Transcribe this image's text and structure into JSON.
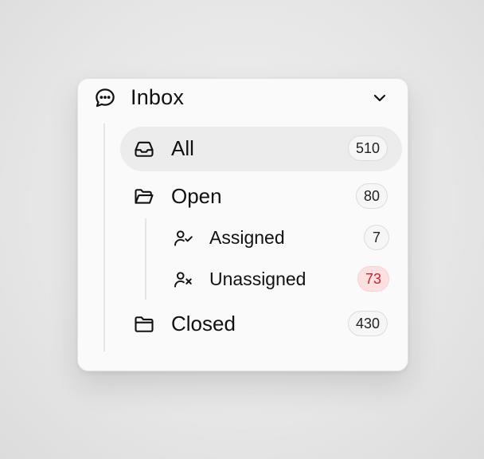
{
  "header": {
    "title": "Inbox",
    "icon": "chat-bubble-icon",
    "toggle_icon": "chevron-down-icon"
  },
  "items": [
    {
      "label": "All",
      "count": "510",
      "icon": "inbox-tray-icon",
      "active": true
    },
    {
      "label": "Open",
      "count": "80",
      "icon": "folder-open-icon"
    },
    {
      "label": "Assigned",
      "count": "7",
      "icon": "user-check-icon"
    },
    {
      "label": "Unassigned",
      "count": "73",
      "icon": "user-x-icon",
      "alert": true
    },
    {
      "label": "Closed",
      "count": "430",
      "icon": "folder-icon"
    }
  ],
  "colors": {
    "alert_badge_bg": "#fde0e0",
    "alert_badge_text": "#d0202a",
    "active_row_bg": "#ececec"
  }
}
